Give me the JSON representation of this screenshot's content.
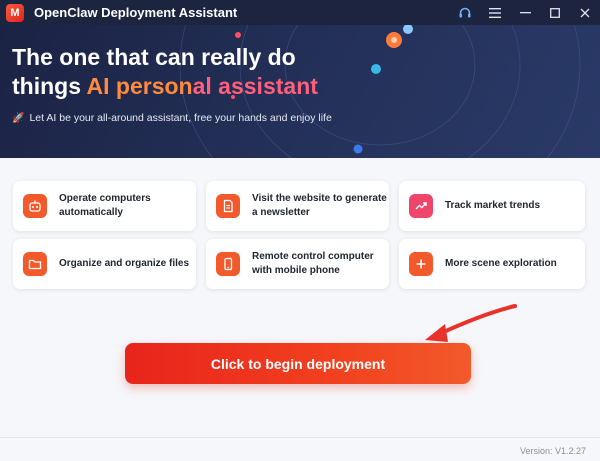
{
  "window": {
    "title": "OpenClaw Deployment Assistant",
    "logo_text": "M",
    "controls": [
      "headset-icon",
      "menu-icon",
      "minimize-icon",
      "maximize-icon",
      "close-icon"
    ]
  },
  "hero": {
    "title_line1": "The one that can really do",
    "title_line2_prefix": "things ",
    "title_line2_accent1": "AI person",
    "title_line2_accent2": "al assistant",
    "subtitle": "Let AI be your all-around assistant, free your hands and enjoy life",
    "subtitle_icon": "rocket-icon"
  },
  "scenes": [
    {
      "label": "Operate computers automatically",
      "icon": "robot-icon",
      "color": "#f25a2c"
    },
    {
      "label": "Visit the website to generate a newsletter",
      "icon": "document-icon",
      "color": "#f25a2c"
    },
    {
      "label": "Track market trends",
      "icon": "trend-icon",
      "color": "#f0456a"
    },
    {
      "label": "Organize and organize files",
      "icon": "folder-icon",
      "color": "#f25a2c"
    },
    {
      "label": "Remote control computer with mobile phone",
      "icon": "phone-icon",
      "color": "#f25a2c"
    },
    {
      "label": "More scene exploration",
      "icon": "plus-icon",
      "color": "#f25a2c"
    }
  ],
  "cta": {
    "label": "Click to begin deployment"
  },
  "footer": {
    "version": "Version: V1.2.27"
  },
  "colors": {
    "titlebar": "#1c2440",
    "hero_bg": "#24315a",
    "accent_orange": "#ff8a3d",
    "accent_pink": "#ff5f7a",
    "cta_red": "#e8241c",
    "arrow_red": "#e8322a"
  }
}
